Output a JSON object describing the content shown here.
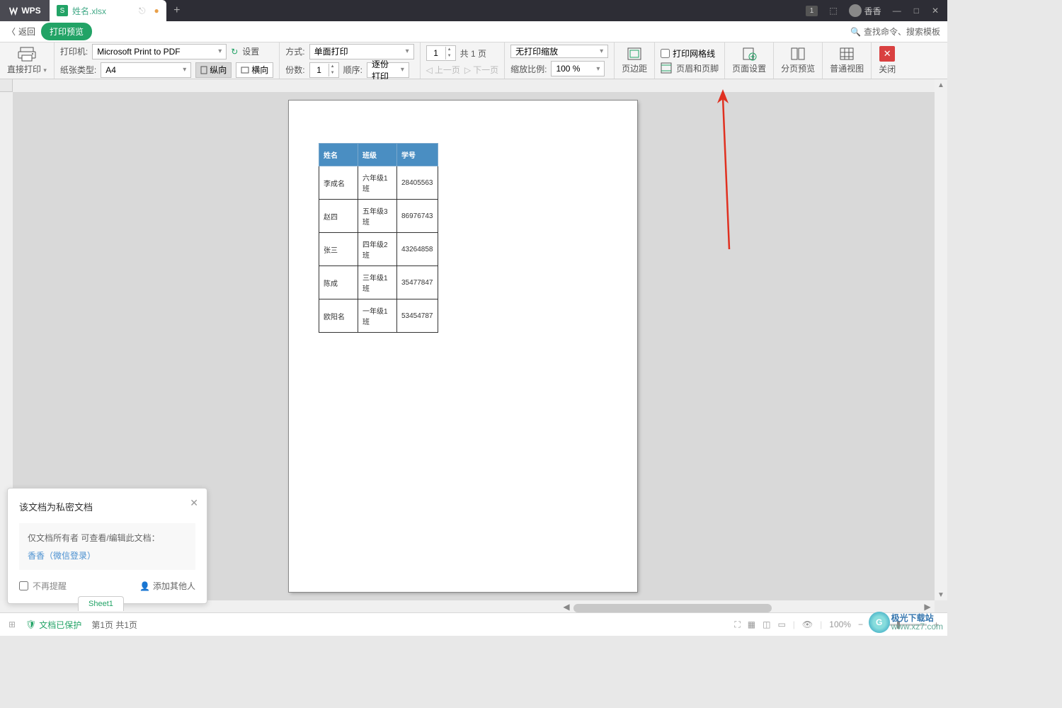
{
  "titlebar": {
    "app": "WPS",
    "tab_name": "姓名.xlsx",
    "badge": "1",
    "username": "香香"
  },
  "nav": {
    "back": "返回",
    "preview": "打印预览",
    "search": "查找命令、搜索模板"
  },
  "ribbon": {
    "direct_print": "直接打印",
    "printer_label": "打印机:",
    "printer_value": "Microsoft Print to PDF",
    "settings": "设置",
    "paper_label": "纸张类型:",
    "paper_value": "A4",
    "portrait": "纵向",
    "landscape": "横向",
    "mode_label": "方式:",
    "mode_value": "单面打印",
    "copies_label": "份数:",
    "copies_value": "1",
    "order_label": "顺序:",
    "order_value": "逐份打印",
    "page_value": "1",
    "page_total": "共 1 页",
    "prev_page": "上一页",
    "next_page": "下一页",
    "scale_label": "无打印缩放",
    "ratio_label": "缩放比例:",
    "ratio_value": "100 %",
    "margins": "页边距",
    "gridlines": "打印网格线",
    "header_footer": "页眉和页脚",
    "page_setup": "页面设置",
    "page_break": "分页预览",
    "normal_view": "普通视图",
    "close": "关闭"
  },
  "table": {
    "headers": [
      "姓名",
      "班级",
      "学号"
    ],
    "rows": [
      [
        "李成名",
        "六年级1班",
        "28405563"
      ],
      [
        "赵四",
        "五年级3班",
        "86976743"
      ],
      [
        "张三",
        "四年级2班",
        "43264858"
      ],
      [
        "陈成",
        "三年级1班",
        "35477847"
      ],
      [
        "欧阳名",
        "一年级1班",
        "53454787"
      ]
    ]
  },
  "popup": {
    "title": "该文档为私密文档",
    "body_text": "仅文档所有者 可查看/编辑此文档：",
    "owner": "香香（微信登录）",
    "no_remind": "不再提醒",
    "add_others": "添加其他人"
  },
  "sheet": {
    "name": "Sheet1"
  },
  "statusbar": {
    "protected": "文档已保护",
    "page_info": "第1页 共1页",
    "zoom": "100%"
  },
  "watermark": {
    "text": "极光下载站",
    "url": "www.xz7.com"
  }
}
